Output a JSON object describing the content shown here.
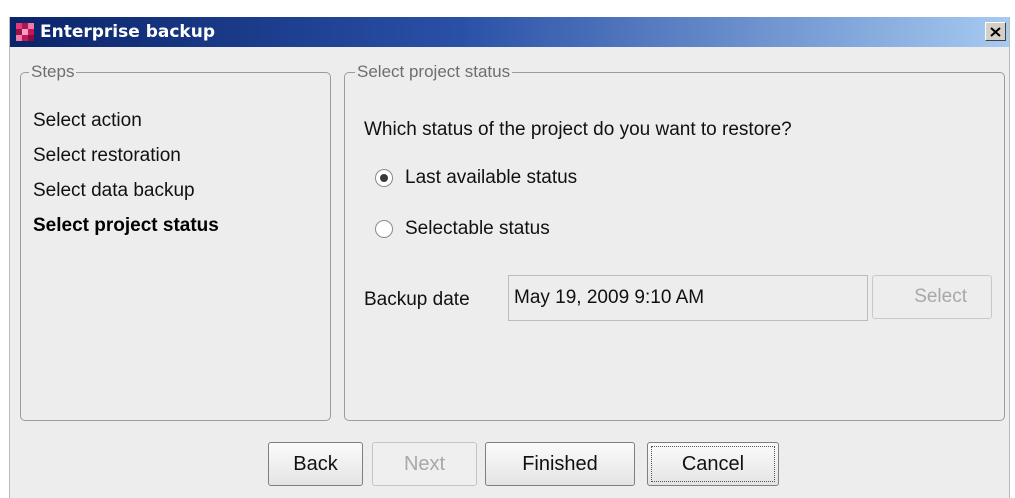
{
  "window": {
    "title": "Enterprise backup",
    "icon": "enterprise-backup-app-icon",
    "close_icon": "close-icon"
  },
  "steps": {
    "legend": "Steps",
    "items": [
      {
        "label": "Select action",
        "current": false
      },
      {
        "label": "Select restoration",
        "current": false
      },
      {
        "label": "Select data backup",
        "current": false
      },
      {
        "label": "Select project status",
        "current": true
      }
    ]
  },
  "status_panel": {
    "legend": "Select project status",
    "question": "Which status of the project do you want to restore?",
    "options": [
      {
        "label": "Last available status",
        "selected": true
      },
      {
        "label": "Selectable status",
        "selected": false
      }
    ],
    "backup_date_label": "Backup date",
    "backup_date_value": "May 19, 2009 9:10 AM",
    "select_button": "Select"
  },
  "buttons": {
    "back": "Back",
    "next": "Next",
    "finished": "Finished",
    "cancel": "Cancel"
  },
  "colors": {
    "title_gradient_start": "#0a246a",
    "title_gradient_end": "#a6caf0",
    "icon_magenta": "#c2185b",
    "dialog_background": "#ededed"
  }
}
